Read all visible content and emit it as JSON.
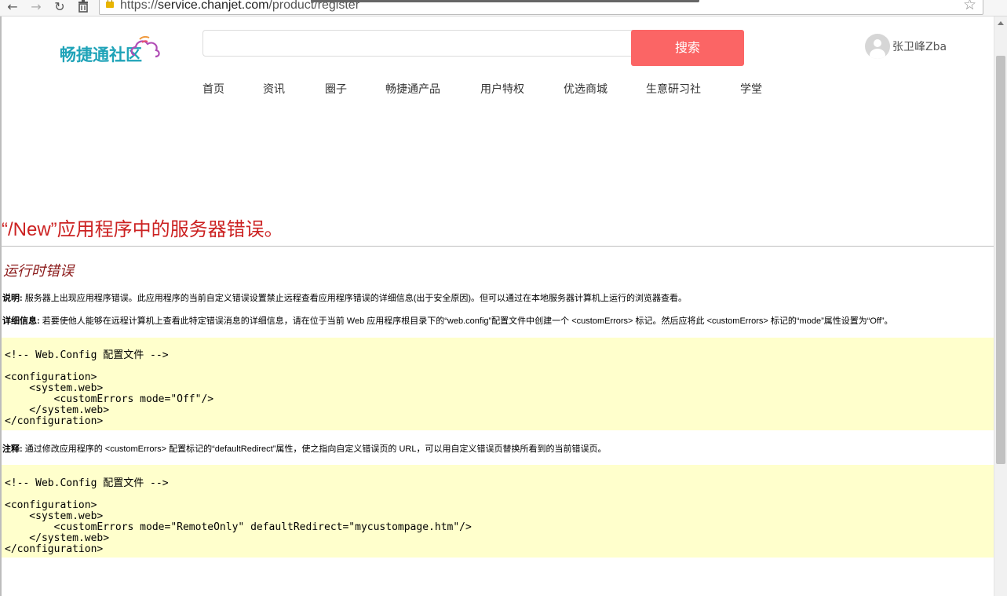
{
  "browser": {
    "url_prefix": "https://",
    "url_host": "service.chanjet.com",
    "url_path": "/product/register",
    "icons": [
      "back-icon",
      "forward-icon",
      "reload-icon",
      "trash-icon",
      "lock-icon",
      "star-icon"
    ]
  },
  "header": {
    "logo_text": "畅捷通社区",
    "search_button": "搜索",
    "search_placeholder": "",
    "username": "张卫峰Zba",
    "accent_color": "#fb6565",
    "logo_color": "#1fa3b8"
  },
  "nav": {
    "items": [
      "首页",
      "资讯",
      "圈子",
      "畅捷通产品",
      "用户特权",
      "优选商城",
      "生意研习社",
      "学堂"
    ]
  },
  "error": {
    "title": "“/New”应用程序中的服务器错误。",
    "subtitle": "运行时错误",
    "desc_label": "说明:",
    "desc_text": " 服务器上出现应用程序错误。此应用程序的当前自定义错误设置禁止远程查看应用程序错误的详细信息(出于安全原因)。但可以通过在本地服务器计算机上运行的浏览器查看。",
    "detail_label": "详细信息:",
    "detail_text": " 若要使他人能够在远程计算机上查看此特定错误消息的详细信息，请在位于当前 Web 应用程序根目录下的“web.config”配置文件中创建一个 <customErrors> 标记。然后应将此 <customErrors> 标记的“mode”属性设置为“Off”。",
    "note_label": "注释:",
    "note_text": " 通过修改应用程序的 <customErrors> 配置标记的“defaultRedirect”属性，使之指向自定义错误页的 URL，可以用自定义错误页替换所看到的当前错误页。",
    "code1": [
      "<!-- Web.Config 配置文件 -->",
      "",
      "<configuration>",
      "    <system.web>",
      "        <customErrors mode=\"Off\"/>",
      "    </system.web>",
      "</configuration>"
    ],
    "code2": [
      "<!-- Web.Config 配置文件 -->",
      "",
      "<configuration>",
      "    <system.web>",
      "        <customErrors mode=\"RemoteOnly\" defaultRedirect=\"mycustompage.htm\"/>",
      "    </system.web>",
      "</configuration>"
    ],
    "title_color": "#cc2222",
    "code_bg": "#ffffcc"
  }
}
